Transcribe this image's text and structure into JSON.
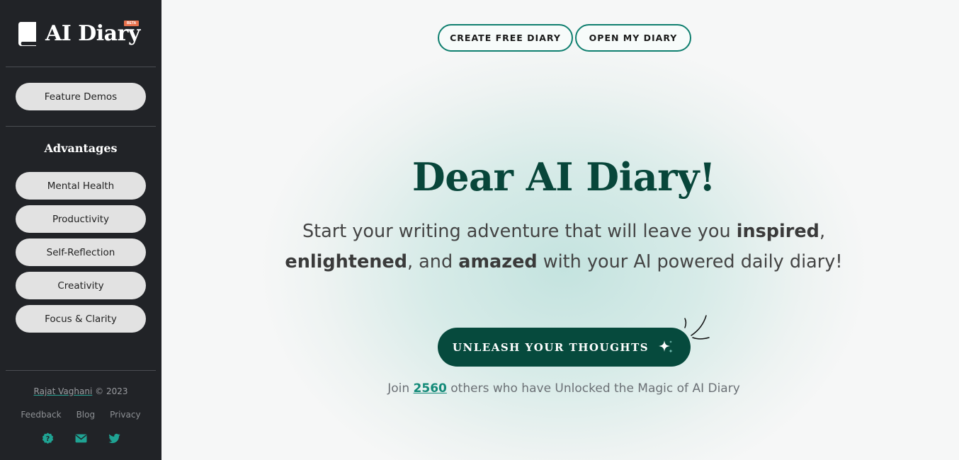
{
  "sidebar": {
    "brand": {
      "name": "AI Diary",
      "badge": "BETA"
    },
    "feature_demos_label": "Feature Demos",
    "advantages_heading": "Advantages",
    "advantages": [
      {
        "label": "Mental Health"
      },
      {
        "label": "Productivity"
      },
      {
        "label": "Self-Reflection"
      },
      {
        "label": "Creativity"
      },
      {
        "label": "Focus & Clarity"
      }
    ],
    "footer": {
      "author": "Rajat Vaghani",
      "copyright": "© 2023",
      "links": [
        "Feedback",
        "Blog",
        "Privacy"
      ],
      "socials": [
        "help-icon",
        "email-icon",
        "twitter-icon"
      ]
    }
  },
  "header": {
    "create_label": "CREATE FREE DIARY",
    "open_label": "OPEN MY DIARY"
  },
  "hero": {
    "title": "Dear AI Diary!",
    "sub_part1": "Start your writing adventure that will leave you ",
    "sub_bold1": "inspired",
    "sub_part2": ",",
    "sub_bold2": "enlightened",
    "sub_part3": ", and ",
    "sub_bold3": "amazed",
    "sub_part4": " with your AI powered daily diary!",
    "cta_label": "UNLEASH YOUR THOUGHTS",
    "cta_icon": "sparkle-icon",
    "join_prefix": "Join ",
    "join_count": "2560",
    "join_suffix": " others who have Unlocked the Magic of AI Diary"
  },
  "colors": {
    "sidebar_bg": "#212327",
    "accent": "#0f7f6f",
    "cta_bg": "#064a3d",
    "title": "#08463a",
    "beta_badge": "#e8714c"
  }
}
